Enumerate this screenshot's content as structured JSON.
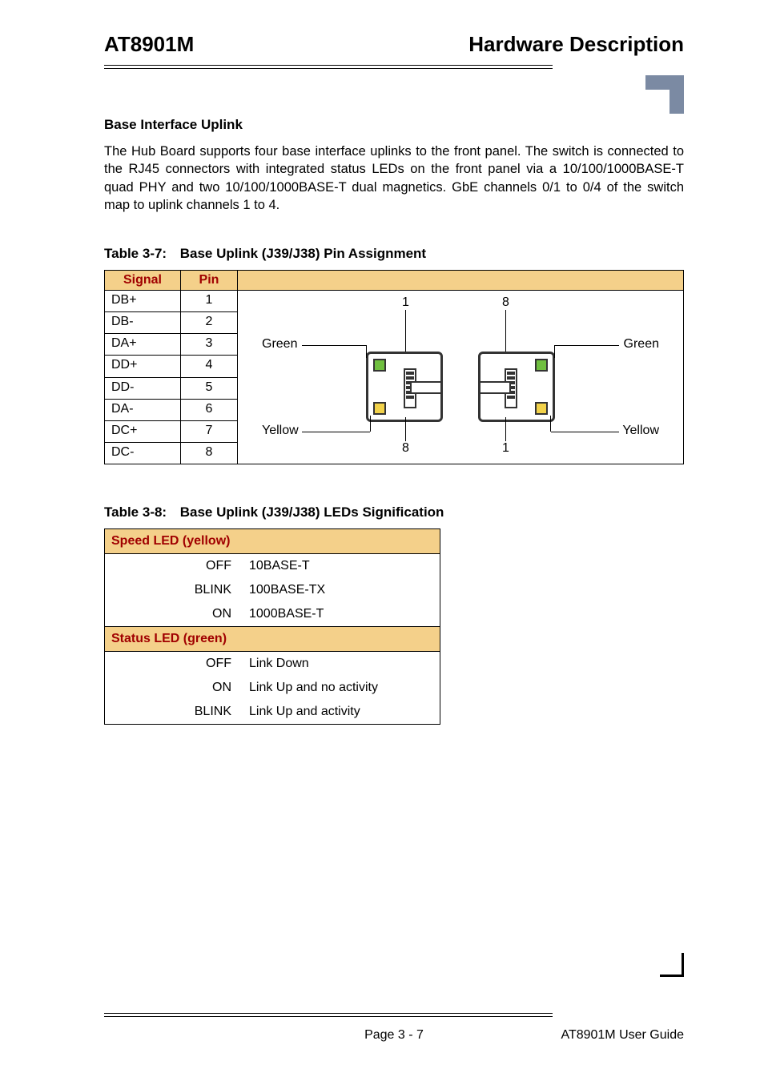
{
  "header": {
    "left": "AT8901M",
    "right": "Hardware Description"
  },
  "section": {
    "heading": "Base Interface Uplink",
    "paragraph": "The Hub Board supports four base interface uplinks to the front panel. The switch is connected to the RJ45 connectors with integrated status LEDs on the front panel via a 10/100/1000BASE-T quad PHY and two 10/100/1000BASE-T dual magnetics. GbE channels 0/1 to 0/4 of the switch map to uplink channels 1 to  4."
  },
  "table37": {
    "caption_num": "Table 3-7:",
    "caption_title": "Base Uplink (J39/J38) Pin Assignment",
    "head_signal": "Signal",
    "head_pin": "Pin",
    "rows": [
      {
        "signal": "DB+",
        "pin": "1"
      },
      {
        "signal": "DB-",
        "pin": "2"
      },
      {
        "signal": "DA+",
        "pin": "3"
      },
      {
        "signal": "DD+",
        "pin": "4"
      },
      {
        "signal": "DD-",
        "pin": "5"
      },
      {
        "signal": "DA-",
        "pin": "6"
      },
      {
        "signal": "DC+",
        "pin": "7"
      },
      {
        "signal": "DC-",
        "pin": "8"
      }
    ],
    "diagram": {
      "top_left_num": "1",
      "top_right_num": "8",
      "bottom_left_num": "8",
      "bottom_right_num": "1",
      "green_left": "Green",
      "green_right": "Green",
      "yellow_left": "Yellow",
      "yellow_right": "Yellow"
    }
  },
  "table38": {
    "caption_num": "Table 3-8:",
    "caption_title": "Base Uplink (J39/J38) LEDs Signification",
    "speed_header": "Speed LED (yellow)",
    "status_header": "Status LED (green)",
    "speed_rows": [
      {
        "state": "OFF",
        "meaning": "10BASE-T"
      },
      {
        "state": "BLINK",
        "meaning": "100BASE-TX"
      },
      {
        "state": "ON",
        "meaning": "1000BASE-T"
      }
    ],
    "status_rows": [
      {
        "state": "OFF",
        "meaning": "Link Down"
      },
      {
        "state": "ON",
        "meaning": "Link Up and no activity"
      },
      {
        "state": "BLINK",
        "meaning": "Link Up and activity"
      }
    ]
  },
  "footer": {
    "page": "Page 3 - 7",
    "guide": "AT8901M User Guide"
  }
}
